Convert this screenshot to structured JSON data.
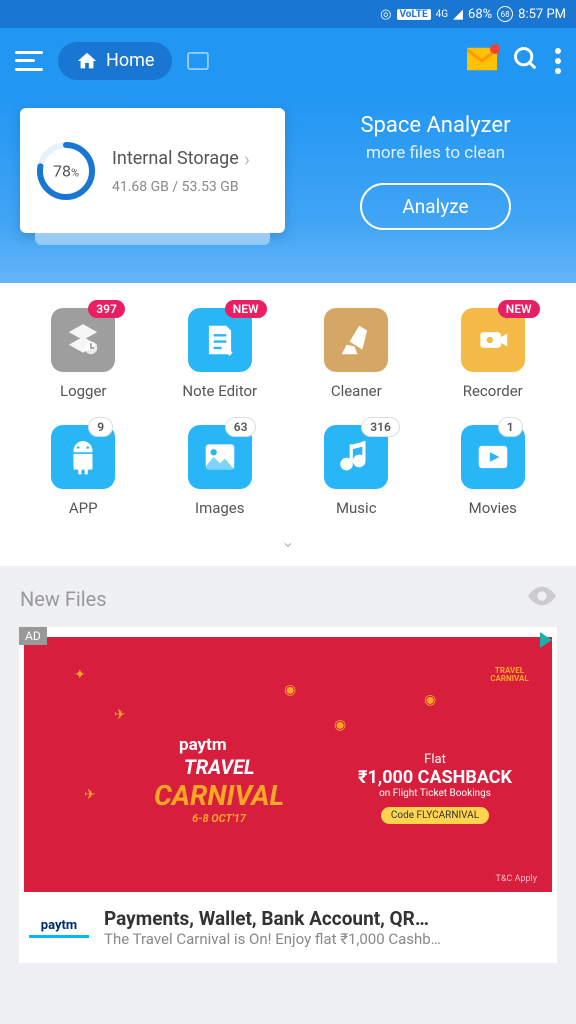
{
  "status": {
    "battery": "68%",
    "time": "8:57 PM",
    "volte": "VoLTE",
    "net": "4G",
    "badge": "68"
  },
  "header": {
    "home": "Home"
  },
  "storage": {
    "percent": "78",
    "title": "Internal Storage",
    "used": "41.68 GB",
    "total": "53.53 GB"
  },
  "analyzer": {
    "title": "Space Analyzer",
    "sub": "more files to clean",
    "btn": "Analyze"
  },
  "grid": [
    {
      "label": "Logger",
      "badge": "397",
      "badgeType": "red",
      "color": "#9e9e9e",
      "icon": "stack"
    },
    {
      "label": "Note Editor",
      "badge": "NEW",
      "badgeType": "red",
      "color": "#29b6f6",
      "icon": "note"
    },
    {
      "label": "Cleaner",
      "badge": "",
      "badgeType": "",
      "color": "#d4a864",
      "icon": "broom"
    },
    {
      "label": "Recorder",
      "badge": "NEW",
      "badgeType": "red",
      "color": "#f5b947",
      "icon": "camera"
    },
    {
      "label": "APP",
      "badge": "9",
      "badgeType": "white",
      "color": "#29b6f6",
      "icon": "android"
    },
    {
      "label": "Images",
      "badge": "63",
      "badgeType": "white",
      "color": "#29b6f6",
      "icon": "image"
    },
    {
      "label": "Music",
      "badge": "316",
      "badgeType": "white",
      "color": "#29b6f6",
      "icon": "music"
    },
    {
      "label": "Movies",
      "badge": "1",
      "badgeType": "white",
      "color": "#29b6f6",
      "icon": "play"
    }
  ],
  "section": {
    "title": "New Files"
  },
  "ad": {
    "tag": "AD",
    "brand": "paytm",
    "carnival_top": "TRAVEL",
    "carnival_main": "CARNIVAL",
    "dates": "6-8 OCT'17",
    "cashback_flat": "Flat",
    "cashback_amt": "₹1,000 CASHBACK",
    "cashback_on": "on Flight Ticket Bookings",
    "code": "Code FLYCARNIVAL",
    "tnc": "T&C Apply",
    "footer_logo": "paytm",
    "footer_title": "Payments, Wallet, Bank Account, QR…",
    "footer_sub": "The Travel Carnival is On! Enjoy flat ₹1,000 Cashb…"
  }
}
